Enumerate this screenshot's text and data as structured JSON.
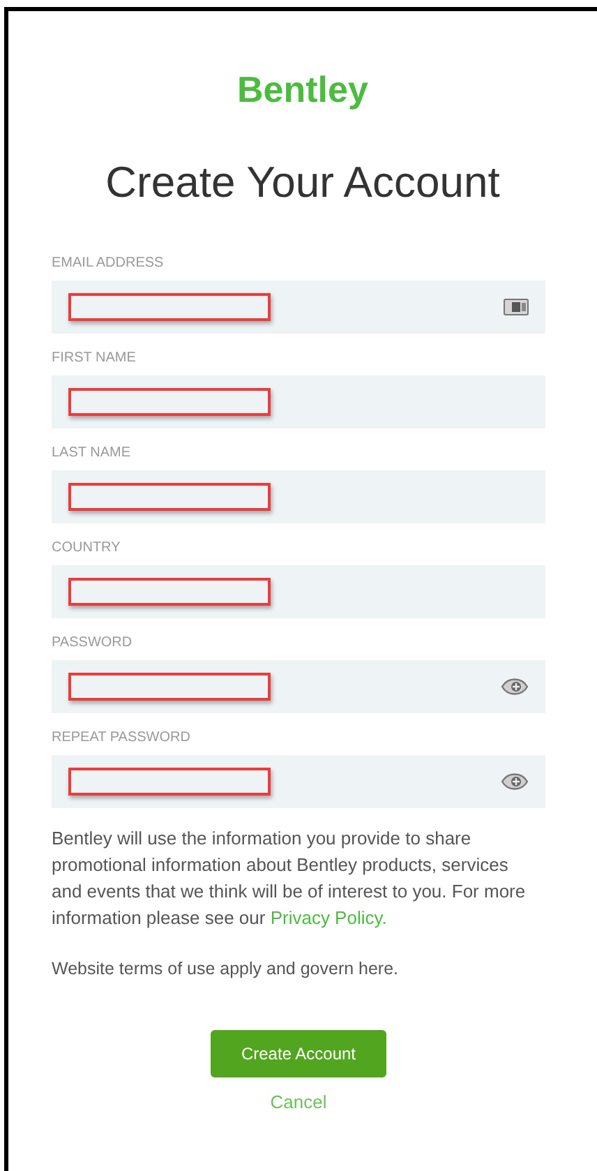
{
  "logo": "Bentley",
  "title": "Create Your Account",
  "fields": [
    {
      "label": "EMAIL ADDRESS",
      "kind": "email",
      "highlighted": true
    },
    {
      "label": "FIRST NAME",
      "kind": "text",
      "highlighted": true
    },
    {
      "label": "LAST NAME",
      "kind": "text",
      "highlighted": true
    },
    {
      "label": "COUNTRY",
      "kind": "text",
      "highlighted": true
    },
    {
      "label": "PASSWORD",
      "kind": "password",
      "highlighted": true
    },
    {
      "label": "REPEAT PASSWORD",
      "kind": "password",
      "highlighted": true
    }
  ],
  "notice": {
    "text": "Bentley will use the information you provide to share promotional information about Bentley products, services and events that we think will be of interest to you. For more information please see our",
    "link": "Privacy Policy."
  },
  "terms": "Website terms of use apply and govern here.",
  "submit_button": "Create Account",
  "cancel_link": "Cancel"
}
